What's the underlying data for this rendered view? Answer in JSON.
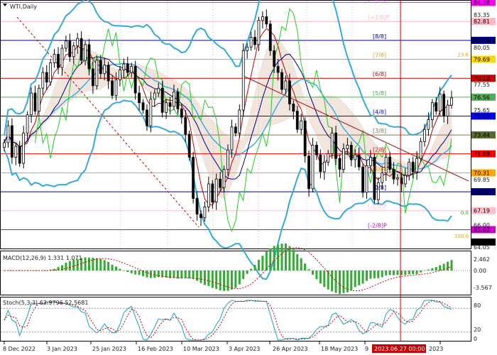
{
  "symbol_label": "WTI,Daily",
  "colors": {
    "candle": "#000000",
    "ichimoku_cloud": "#d7b49e",
    "bollinger": "#33aadd",
    "ma_red": "#c00000",
    "ma_green": "#22cc22",
    "ma_navy": "#000080",
    "grid_dots": "#bbbbbb",
    "date_marker": "#cc0000"
  },
  "price_axis": [
    "83.35",
    "80.05",
    "77.55",
    "75.65",
    "69.85",
    "66.00",
    "64.05"
  ],
  "price_badges": [
    {
      "text": "84.38",
      "value": 84.38,
      "bg": "#ff00ff",
      "fg": "#ffffff"
    },
    {
      "text": "82.81",
      "value": 82.81,
      "bg": "#ffb6c1",
      "fg": "#ffffff"
    },
    {
      "text": "81.25",
      "value": 81.25,
      "bg": "#000080",
      "fg": "#ffffff"
    },
    {
      "text": "79.69",
      "value": 79.69,
      "bg": "#ffd700",
      "fg": "#000000"
    },
    {
      "text": "78.12",
      "value": 78.12,
      "bg": "#cc0000",
      "fg": "#ffffff"
    },
    {
      "text": "76.56",
      "value": 76.56,
      "bg": "#55aa55",
      "fg": "#ffffff"
    },
    {
      "text": "75.00",
      "value": 75.0,
      "bg": "#0000ff",
      "fg": "#ffffff"
    },
    {
      "text": "73.44",
      "value": 73.44,
      "bg": "#556b2f",
      "fg": "#ffffff"
    },
    {
      "text": "71.88",
      "value": 71.88,
      "bg": "#ff0000",
      "fg": "#ffffff"
    },
    {
      "text": "70.31",
      "value": 70.31,
      "bg": "#ffa500",
      "fg": "#ffffff"
    },
    {
      "text": "68.75",
      "value": 68.75,
      "bg": "#000080",
      "fg": "#ffffff"
    },
    {
      "text": "67.19",
      "value": 67.19,
      "bg": "#ffc0cb",
      "fg": "#ffffff"
    },
    {
      "text": "65.62",
      "value": 65.62,
      "bg": "#cc00cc",
      "fg": "#ffffff"
    },
    {
      "text": "64.60",
      "value": 64.6,
      "bg": "#000000",
      "fg": "#ffffff"
    }
  ],
  "murrey_levels": [
    {
      "label": "[+2/8]P",
      "value": 84.38,
      "color": "#ff00ff",
      "label_x": 518
    },
    {
      "label": "[+1/8]P",
      "value": 82.81,
      "color": "#ffb6c1",
      "label_x": 518
    },
    {
      "label": "[8/8]",
      "value": 81.25,
      "color": "#000080",
      "label_x": 525
    },
    {
      "label": "[7/8]",
      "value": 79.69,
      "color": "#daa520",
      "label_x": 525
    },
    {
      "label": "[6/8]",
      "value": 78.12,
      "color": "#cc0000",
      "label_x": 525
    },
    {
      "label": "[5/8]",
      "value": 76.56,
      "color": "#55aa55",
      "label_x": 525
    },
    {
      "label": "[4/8]",
      "value": 75.0,
      "color": "#0000ff",
      "label_x": 525
    },
    {
      "label": "[3/8]",
      "value": 73.44,
      "color": "#8b7355",
      "label_x": 525
    },
    {
      "label": "[2/8]",
      "value": 71.88,
      "color": "#ff0000",
      "label_x": 525
    },
    {
      "label": "[1/8]",
      "value": 70.31,
      "color": "#ffa500",
      "label_x": 525
    },
    {
      "label": "[0/8]",
      "value": 68.75,
      "color": "#000080",
      "label_x": 525
    },
    {
      "label": "[-1/8]P",
      "value": 67.19,
      "color": "#ffc0cb",
      "label_x": 518
    },
    {
      "label": "[-2/8]P",
      "value": 65.62,
      "color": "#cc00cc",
      "label_x": 518
    }
  ],
  "fib_labels": [
    {
      "text": "23.6",
      "value": 79.85,
      "color": "#daa520"
    },
    {
      "text": "0.0",
      "value": 66.82,
      "color": "#33aa33"
    },
    {
      "text": "100.0",
      "value": 64.9,
      "color": "#daa520"
    }
  ],
  "macd": {
    "label": "MACD(12,26,9) 1.331 1.071",
    "axis": [
      "2.462",
      "0.00",
      "-3.567"
    ],
    "ylim": [
      -3.567,
      2.462
    ]
  },
  "stoch": {
    "label": "Stoch(5,3,3) 63.9796 52.5681",
    "axis": [
      "80",
      "20",
      "0"
    ]
  },
  "time_axis": [
    "8 Dec 2022",
    "3 Jan 2023",
    "25 Jan 2023",
    "16 Feb 2023",
    "10 Mar 2023",
    "3 Apr 2023",
    "26 Apr 2023",
    "18 May 2023",
    "9",
    "2023.06.27 00:00",
    "2023"
  ],
  "crosshair_time": "2023.06.27 00:00",
  "chart_data": {
    "type": "line",
    "ylim": [
      64.05,
      84.6
    ],
    "close": [
      72.8,
      74.2,
      71.6,
      72.5,
      71.1,
      73.6,
      75.1,
      76.9,
      75.4,
      77.3,
      78.6,
      77.8,
      79.4,
      80.1,
      79.0,
      80.6,
      81.2,
      79.9,
      80.8,
      81.4,
      79.6,
      80.9,
      78.9,
      77.5,
      79.6,
      78.5,
      79.2,
      77.9,
      76.7,
      78.0,
      78.8,
      79.3,
      78.6,
      79.1,
      76.9,
      76.1,
      75.5,
      74.2,
      76.4,
      76.9,
      77.3,
      75.3,
      76.1,
      75.8,
      77.0,
      75.6,
      74.9,
      73.5,
      71.6,
      68.2,
      66.9,
      66.6,
      67.5,
      69.4,
      67.9,
      69.8,
      69.1,
      70.6,
      72.2,
      74.1,
      73.6,
      75.5,
      80.4,
      80.7,
      81.5,
      80.9,
      82.9,
      83.2,
      82.6,
      80.4,
      79.1,
      78.6,
      77.2,
      77.9,
      76.0,
      75.4,
      73.9,
      74.6,
      71.7,
      69.0,
      72.6,
      71.8,
      70.4,
      71.2,
      71.9,
      73.6,
      71.5,
      70.6,
      72.3,
      72.6,
      71.4,
      71.8,
      70.8,
      68.7,
      70.9,
      71.6,
      68.1,
      69.5,
      70.3,
      71.6,
      70.6,
      69.8,
      69.9,
      69.4,
      70.1,
      71.2,
      70.4,
      71.5,
      72.9,
      73.9,
      74.7,
      76.1,
      75.4,
      76.8,
      75.0,
      75.9,
      76.5
    ]
  }
}
